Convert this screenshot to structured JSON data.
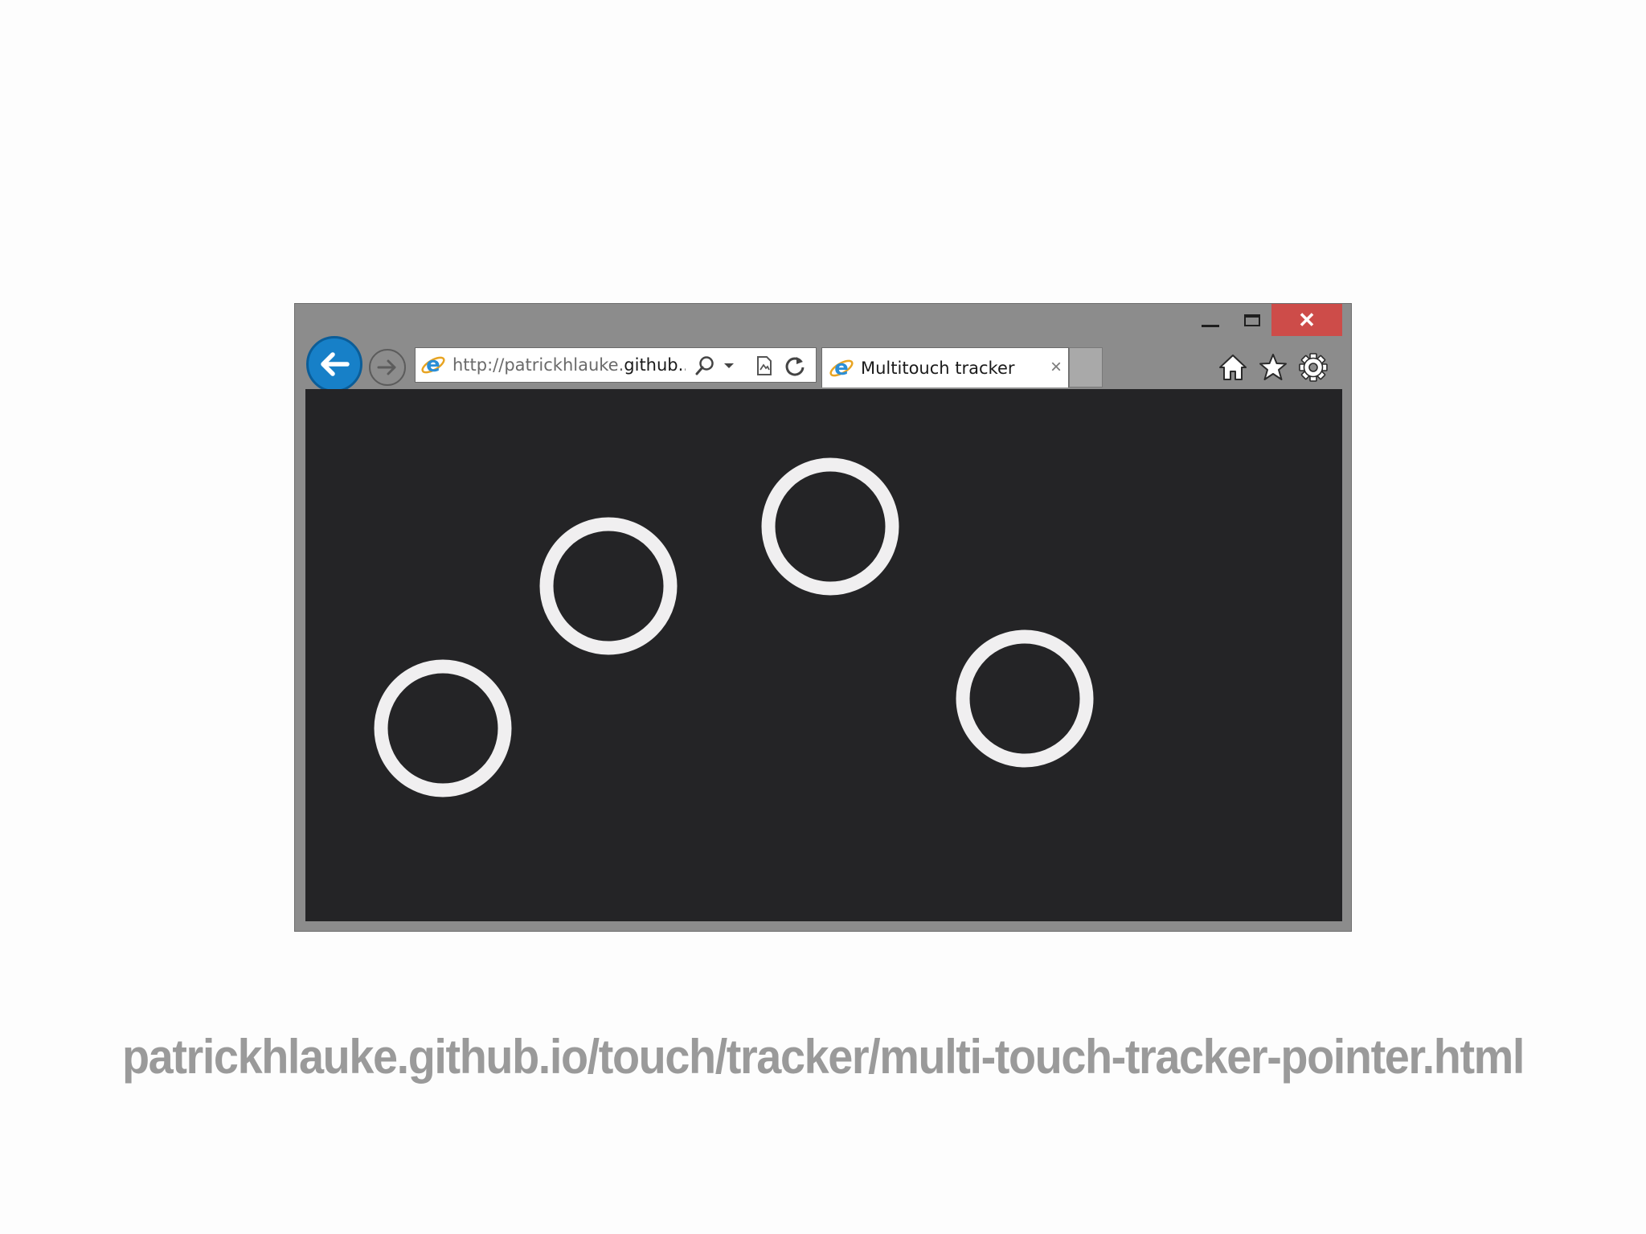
{
  "browser": {
    "window_controls": {
      "minimize_label": "–",
      "maximize_label": "□",
      "close_label": "✕",
      "close_color": "#cd4c49"
    },
    "nav": {
      "back_icon": "back-arrow-icon",
      "forward_icon": "forward-arrow-icon",
      "accent": "#1780c8"
    },
    "address_bar": {
      "url_prefix": "http://patrickhlauke.",
      "url_host": "github...",
      "icons": [
        "search-icon",
        "dropdown-icon",
        "compat-view-icon",
        "refresh-icon"
      ]
    },
    "tab": {
      "title": "Multitouch tracker",
      "close_label": "×"
    },
    "toolbar_icons": [
      "home-icon",
      "star-icon",
      "gear-icon"
    ],
    "content": {
      "background": "#242426",
      "ring_color": "#f0eff0",
      "touch_points_count": 4
    }
  },
  "caption": {
    "text": "patrickhlauke.github.io/touch/tracker/multi-touch-tracker-pointer.html",
    "color": "#9a9a9a"
  }
}
